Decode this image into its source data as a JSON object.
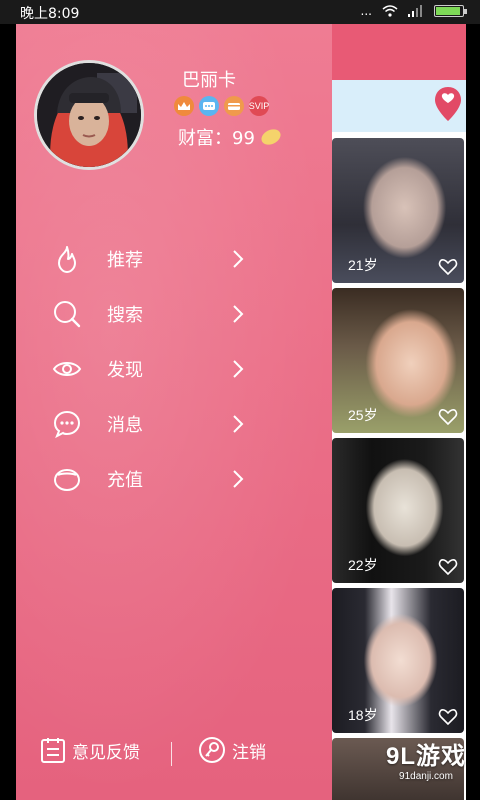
{
  "status_bar": {
    "time": "晚上8:09",
    "signal": "..."
  },
  "profile": {
    "username": "巴丽卡",
    "wealth_label": "财富：99",
    "badges": [
      {
        "icon": "crown-icon",
        "color": "#f08a3c",
        "text": ""
      },
      {
        "icon": "chat-icon",
        "color": "#5bb5f0",
        "text": ""
      },
      {
        "icon": "card-icon",
        "color": "#f09a4c",
        "text": ""
      },
      {
        "icon": "svip-icon",
        "color": "#e04a55",
        "text": "SVIP"
      }
    ]
  },
  "menu": [
    {
      "icon": "flame-icon",
      "label": "推荐"
    },
    {
      "icon": "search-icon",
      "label": "搜索"
    },
    {
      "icon": "eye-icon",
      "label": "发现"
    },
    {
      "icon": "message-icon",
      "label": "消息"
    },
    {
      "icon": "wallet-icon",
      "label": "充值"
    }
  ],
  "footer": {
    "feedback_label": "意见反馈",
    "logout_label": "注销"
  },
  "photos": [
    {
      "age": "21岁"
    },
    {
      "age": "25岁"
    },
    {
      "age": "22岁"
    },
    {
      "age": "18岁"
    }
  ],
  "watermark": {
    "logo": "9L游戏",
    "site": "91danji.com"
  },
  "colors": {
    "drawer": "#eb6f88",
    "header": "#e85a75"
  }
}
